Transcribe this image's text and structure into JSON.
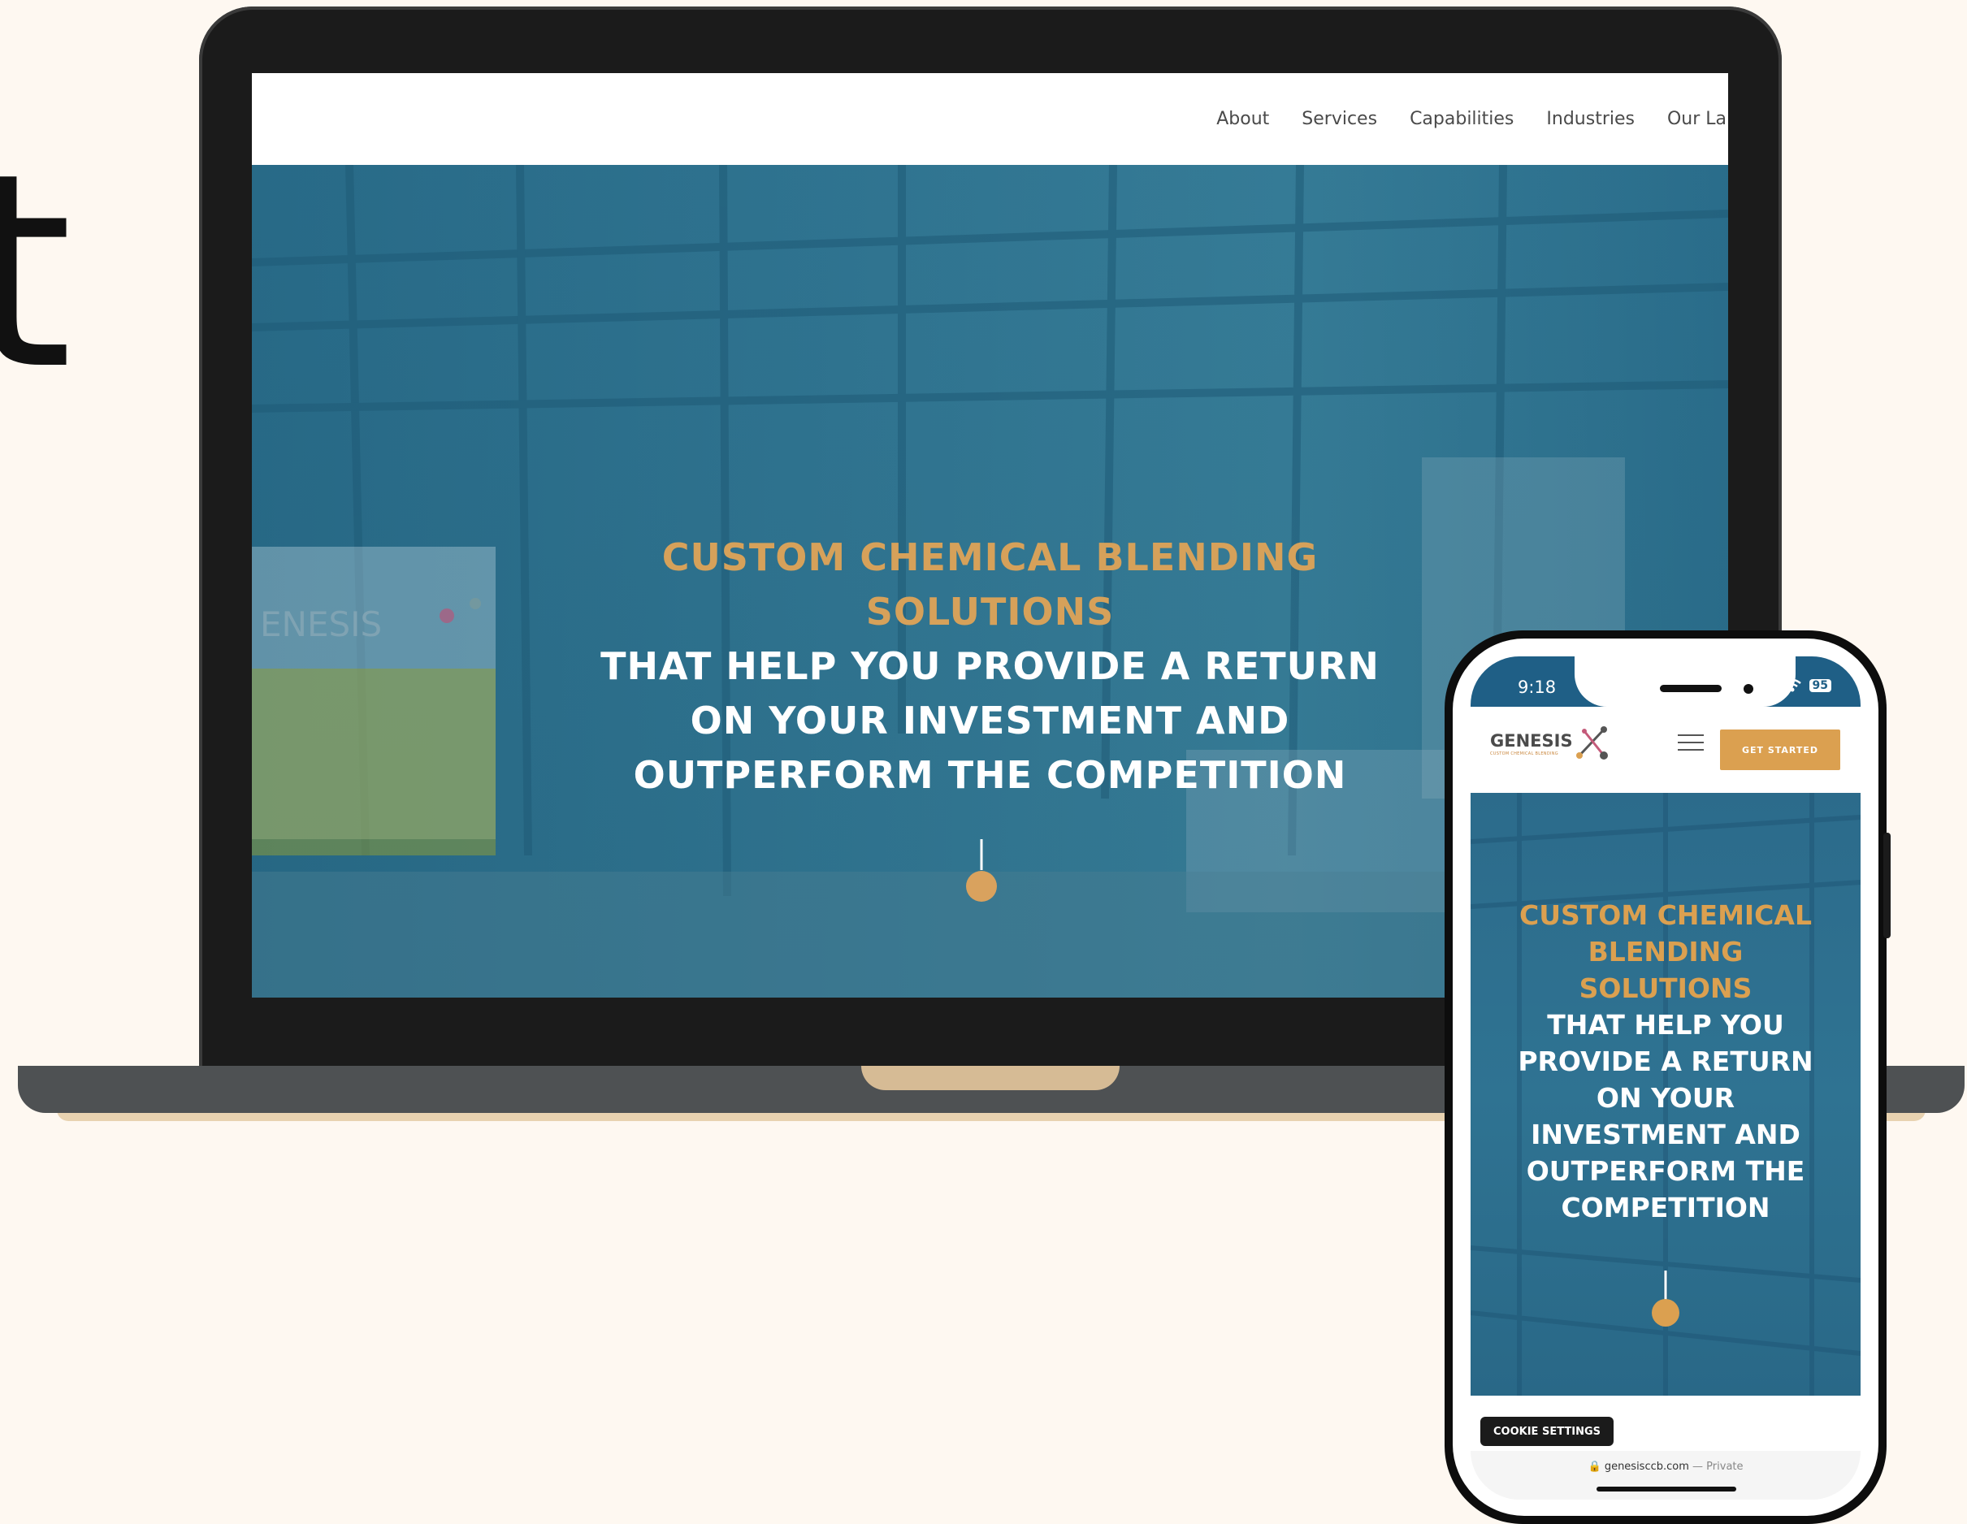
{
  "page": {
    "big_letter": "t"
  },
  "laptop": {
    "nav": [
      "About",
      "Services",
      "Capabilities",
      "Industries",
      "Our Lab"
    ],
    "hero": {
      "headline_gold_1": "CUSTOM CHEMICAL BLENDING",
      "headline_gold_2": "SOLUTIONS",
      "headline_white_1": "THAT HELP YOU PROVIDE A RETURN",
      "headline_white_2": "ON YOUR INVESTMENT AND",
      "headline_white_3": "OUTPERFORM THE COMPETITION",
      "sign_text": "ENESIS"
    }
  },
  "phone": {
    "status": {
      "time": "9:18",
      "battery": "95"
    },
    "logo": {
      "word": "GENESIS",
      "tagline": "CUSTOM CHEMICAL BLENDING"
    },
    "cta_label": "GET STARTED",
    "hero": {
      "gold_1": "CUSTOM CHEMICAL",
      "gold_2": "BLENDING",
      "gold_3": "SOLUTIONS",
      "white_1": "THAT HELP YOU",
      "white_2": "PROVIDE A RETURN",
      "white_3": "ON YOUR",
      "white_4": "INVESTMENT AND",
      "white_5": "OUTPERFORM THE",
      "white_6": "COMPETITION"
    },
    "cookie_label": "COOKIE SETTINGS",
    "url": {
      "domain": "genesisccb.com",
      "suffix": "— Private"
    }
  },
  "colors": {
    "gold": "#d6a15a",
    "hero_blue": "#2f7392",
    "page_bg": "#fef8f1"
  }
}
